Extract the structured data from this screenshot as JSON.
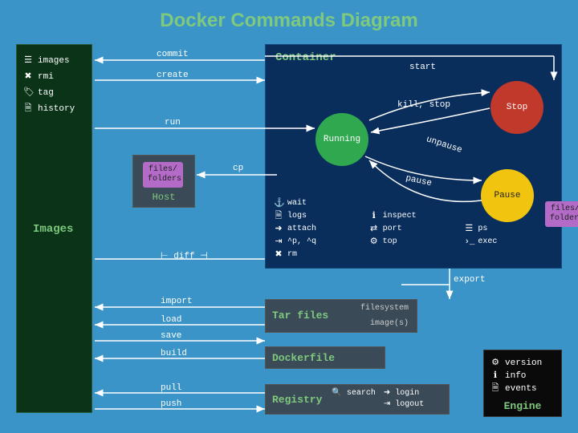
{
  "title": "Docker Commands Diagram",
  "images": {
    "label": "Images",
    "items": [
      "images",
      "rmi",
      "tag",
      "history"
    ]
  },
  "container": {
    "label": "Container",
    "states": {
      "running": "Running",
      "stop": "Stop",
      "pause": "Pause"
    },
    "transitions": {
      "start": "start",
      "kill_stop": "kill, stop",
      "pause": "pause",
      "unpause": "unpause"
    },
    "files_folders": "files/\nfolders",
    "commands": [
      "wait",
      "logs",
      "inspect",
      "attach",
      "port",
      "ps",
      "^p, ^q",
      "top",
      "rm",
      "exec"
    ]
  },
  "host": {
    "label": "Host"
  },
  "arrows": {
    "commit": "commit",
    "create": "create",
    "run": "run",
    "cp": "cp",
    "diff": "diff",
    "import": "import",
    "export": "export",
    "load": "load",
    "save": "save",
    "build": "build",
    "pull": "pull",
    "push": "push"
  },
  "tar": {
    "label": "Tar files",
    "filesystem": "filesystem",
    "images": "image(s)"
  },
  "dockerfile": {
    "label": "Dockerfile"
  },
  "registry": {
    "label": "Registry",
    "commands": [
      "search",
      "login",
      "logout"
    ]
  },
  "engine": {
    "label": "Engine",
    "commands": [
      "version",
      "info",
      "events"
    ]
  }
}
